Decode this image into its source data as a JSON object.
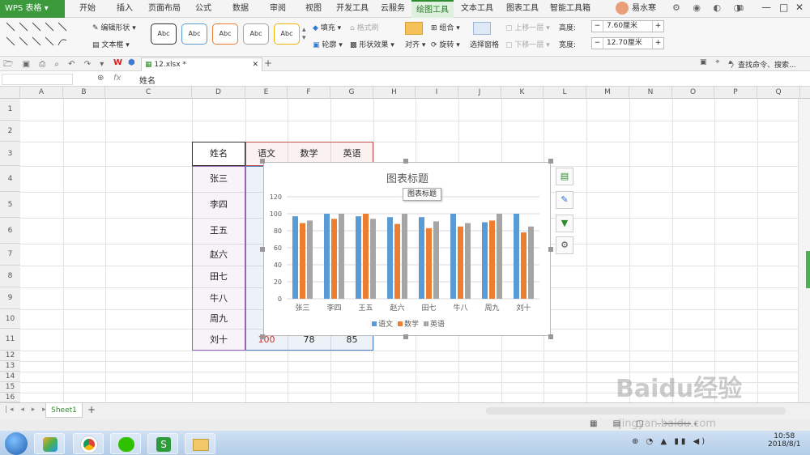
{
  "menu": {
    "app": "WPS 表格",
    "tabs": [
      "开始",
      "插入",
      "页面布局",
      "公式",
      "数据",
      "审阅",
      "视图",
      "开发工具",
      "云服务",
      "绘图工具",
      "文本工具",
      "图表工具",
      "智能工具箱"
    ],
    "active_tab": "绘图工具",
    "user": "易水寒"
  },
  "ribbon": {
    "edit_shape": "编辑形状",
    "textbox": "文本框",
    "styles": [
      "Abc",
      "Abc",
      "Abc",
      "Abc",
      "Abc"
    ],
    "fill": "填充",
    "format_painter": "格式刷",
    "outline": "轮廓",
    "shape_effect": "形状效果",
    "align": "对齐",
    "group": "组合",
    "rotate": "旋转",
    "select_pane": "选择窗格",
    "bring_forward": "上移一层",
    "send_backward": "下移一层",
    "height_label": "高度:",
    "height_value": "7.60厘米",
    "width_label": "宽度:",
    "width_value": "12.70厘米"
  },
  "doc": {
    "tab_name": "12.xlsx *",
    "search_placeholder": "查找命令、搜索..."
  },
  "formula": {
    "fx": "fx",
    "content": "姓名"
  },
  "columns": [
    "A",
    "B",
    "C",
    "D",
    "E",
    "F",
    "G",
    "H",
    "I",
    "J",
    "K",
    "L",
    "M",
    "N",
    "O",
    "P",
    "Q"
  ],
  "rows": [
    "1",
    "2",
    "3",
    "4",
    "5",
    "6",
    "7",
    "8",
    "9",
    "10",
    "11",
    "12",
    "13",
    "14",
    "15",
    "16"
  ],
  "table": {
    "headers": [
      "姓名",
      "语文",
      "数学",
      "英语"
    ],
    "names": [
      "张三",
      "李四",
      "王五",
      "赵六",
      "田七",
      "牛八",
      "周九",
      "刘十"
    ],
    "last_row_values": [
      "100",
      "78",
      "85"
    ]
  },
  "chart_data": {
    "type": "bar",
    "title": "图表标题",
    "tooltip": "图表标题",
    "categories": [
      "张三",
      "李四",
      "王五",
      "赵六",
      "田七",
      "牛八",
      "周九",
      "刘十"
    ],
    "series": [
      {
        "name": "语文",
        "color": "#5b9bd5",
        "values": [
          97,
          100,
          97,
          96,
          96,
          100,
          90,
          100
        ]
      },
      {
        "name": "数学",
        "color": "#ed7d31",
        "values": [
          89,
          94,
          100,
          88,
          83,
          85,
          92,
          78
        ]
      },
      {
        "name": "英语",
        "color": "#a5a5a5",
        "values": [
          92,
          100,
          94,
          100,
          91,
          89,
          100,
          85
        ]
      }
    ],
    "ylim": [
      0,
      120
    ],
    "yticks": [
      "0",
      "20",
      "40",
      "60",
      "80",
      "100",
      "120"
    ],
    "grid": true,
    "legend_position": "bottom"
  },
  "sheet": {
    "tab": "Sheet1"
  },
  "taskbar": {
    "time": "10:58",
    "date": "2018/8/1"
  },
  "watermark": "Baidu经验 jingyan.baidu.com"
}
